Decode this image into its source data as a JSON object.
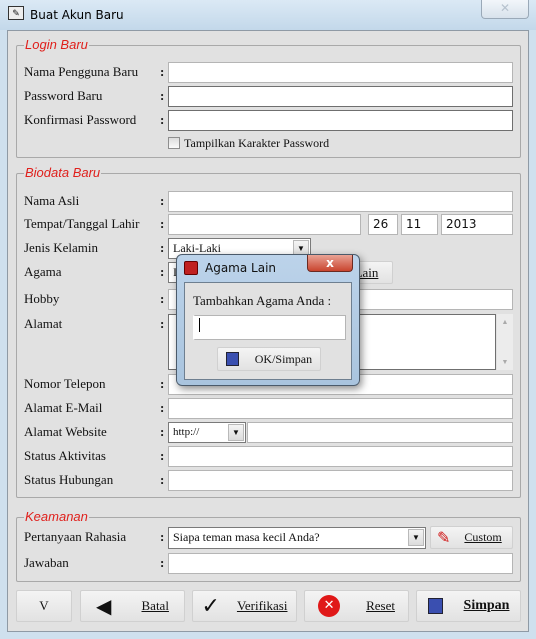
{
  "window": {
    "title": "Buat Akun Baru",
    "close": "✕"
  },
  "login": {
    "legend": "Login Baru",
    "fields": [
      {
        "label": "Nama Pengguna Baru",
        "value": ""
      },
      {
        "label": "Password Baru",
        "value": ""
      },
      {
        "label": "Konfirmasi Password",
        "value": ""
      }
    ],
    "show_password": "Tampilkan Karakter Password"
  },
  "colon": ":",
  "biodata": {
    "legend": "Biodata Baru",
    "nama_asli": "Nama Asli",
    "ttl": "Tempat/Tanggal Lahir",
    "day": "26",
    "month": "11",
    "year": "2013",
    "jenis_kelamin": "Jenis Kelamin",
    "gender_value": "Laki-Laki",
    "agama": "Agama",
    "agama_value": "I",
    "agama_lain_button": "Lain",
    "hobby": "Hobby",
    "alamat": "Alamat",
    "telepon": "Nomor Telepon",
    "email": "Alamat E-Mail",
    "website": "Alamat Website",
    "website_protocol": "http://",
    "status_aktivitas": "Status Aktivitas",
    "status_hubungan": "Status Hubungan"
  },
  "keamanan": {
    "legend": "Keamanan",
    "pertanyaan": "Pertanyaan Rahasia",
    "pertanyaan_value": "Siapa teman masa kecil Anda?",
    "custom_button": "Custom",
    "jawaban": "Jawaban"
  },
  "buttons": {
    "v": "V",
    "batal": "Batal",
    "verifikasi": "Verifikasi",
    "reset": "Reset",
    "simpan": "Simpan"
  },
  "dialog": {
    "title": "Agama Lain",
    "close": "x",
    "prompt": "Tambahkan Agama Anda :",
    "input_value": "",
    "ok_button": "OK/Simpan"
  }
}
